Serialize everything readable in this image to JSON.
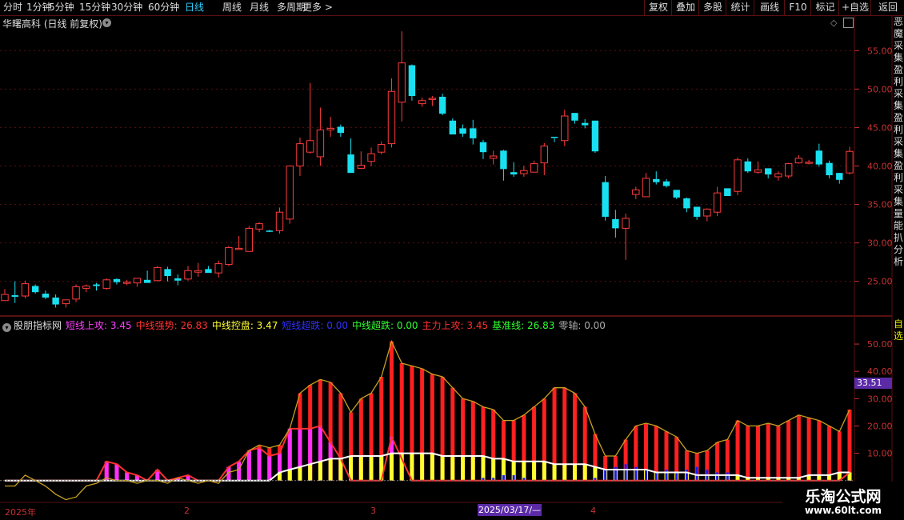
{
  "toolbar": {
    "periods": [
      "分时",
      "1分钟",
      "5分钟",
      "15分钟",
      "30分钟",
      "60分钟",
      "日线",
      "周线",
      "月线",
      "多周期",
      "更多 >"
    ],
    "active_period": "日线",
    "right_buttons": [
      "复权",
      "叠加",
      "多股",
      "统计",
      "画线",
      "F10",
      "标记",
      "+自选",
      "返回"
    ]
  },
  "stock": {
    "title": "华曙高科 (日线 前复权)"
  },
  "side_text": "恶魔采集盈利采集盈利采集盈利采集量能扒分析",
  "side_text_2": "自选",
  "indicator": {
    "name": "股朋指标网",
    "values": [
      {
        "label": "短线上攻:",
        "value": "3.45",
        "color": "#ff40ff"
      },
      {
        "label": "中线强势:",
        "value": "26.83",
        "color": "#ff3030"
      },
      {
        "label": "中线控盘:",
        "value": "3.47",
        "color": "#ffff30"
      },
      {
        "label": "短线超跌:",
        "value": "0.00",
        "color": "#3030ff"
      },
      {
        "label": "中线超跌:",
        "value": "0.00",
        "color": "#30ff30"
      },
      {
        "label": "主力上攻:",
        "value": "3.45",
        "color": "#ff3030"
      },
      {
        "label": "基准线:",
        "value": "26.83",
        "color": "#30ff30"
      },
      {
        "label": "零轴:",
        "value": "0.00",
        "color": "#aaaaaa"
      }
    ],
    "current_label": "33.51"
  },
  "x_axis": {
    "labels": [
      "2025年",
      "2",
      "3",
      "4"
    ],
    "date_badge": "2025/03/17/—"
  },
  "watermark": {
    "title": "乐淘公式网",
    "url": "www.60lt.com"
  },
  "colors": {
    "up": "#ff3c3c",
    "down": "#19e0f0",
    "grid": "#5a1010",
    "axis": "#c83232"
  },
  "chart_data": [
    {
      "type": "candlestick",
      "ylabel_ticks": [
        "55.00",
        "50.00",
        "45.00",
        "40.00",
        "35.00",
        "30.00",
        "25.00"
      ],
      "y_ticks": [
        55,
        50,
        45,
        40,
        35,
        30,
        25
      ],
      "ylim": [
        20.5,
        59.5
      ],
      "ohlc": [
        [
          22.5,
          24.0,
          22.5,
          23.3
        ],
        [
          23.2,
          25.0,
          22.2,
          23.0
        ],
        [
          23.1,
          25.1,
          22.8,
          24.7
        ],
        [
          24.4,
          24.6,
          23.4,
          23.6
        ],
        [
          23.4,
          23.8,
          22.7,
          22.9
        ],
        [
          22.9,
          23.3,
          21.6,
          22.0
        ],
        [
          22.1,
          22.6,
          21.6,
          22.6
        ],
        [
          22.7,
          24.6,
          22.3,
          24.3
        ],
        [
          24.1,
          24.6,
          23.6,
          24.4
        ],
        [
          24.6,
          24.8,
          23.8,
          24.4
        ],
        [
          24.1,
          25.4,
          23.9,
          25.2
        ],
        [
          25.3,
          25.4,
          24.6,
          24.9
        ],
        [
          24.9,
          25.2,
          24.5,
          24.9
        ],
        [
          24.8,
          25.4,
          24.3,
          25.4
        ],
        [
          25.2,
          26.4,
          25.1,
          24.8
        ],
        [
          25.1,
          27.0,
          25.0,
          26.8
        ],
        [
          26.6,
          26.9,
          25.0,
          25.7
        ],
        [
          25.4,
          25.9,
          24.5,
          25.1
        ],
        [
          25.3,
          27.0,
          25.1,
          26.4
        ],
        [
          26.2,
          27.4,
          25.6,
          26.4
        ],
        [
          26.6,
          27.0,
          26.2,
          26.1
        ],
        [
          26.1,
          27.7,
          25.5,
          27.3
        ],
        [
          27.2,
          29.6,
          27.0,
          29.4
        ],
        [
          29.3,
          30.9,
          29.2,
          29.3
        ],
        [
          28.9,
          32.2,
          28.9,
          31.9
        ],
        [
          31.8,
          32.7,
          31.4,
          32.5
        ],
        [
          31.6,
          31.7,
          31.4,
          31.5
        ],
        [
          31.6,
          34.6,
          31.2,
          34.0
        ],
        [
          33.1,
          40.1,
          32.5,
          40.0
        ],
        [
          40.0,
          43.7,
          38.7,
          42.9
        ],
        [
          41.8,
          50.8,
          41.6,
          43.3
        ],
        [
          41.2,
          47.6,
          40.0,
          44.7
        ],
        [
          44.7,
          46.4,
          43.8,
          44.9
        ],
        [
          45.1,
          45.4,
          43.8,
          44.3
        ],
        [
          41.5,
          43.6,
          39.2,
          39.1
        ],
        [
          39.7,
          41.9,
          39.6,
          40.1
        ],
        [
          40.6,
          42.4,
          40.0,
          41.6
        ],
        [
          41.8,
          43.2,
          41.5,
          42.8
        ],
        [
          42.9,
          51.4,
          42.4,
          49.7
        ],
        [
          48.3,
          57.5,
          45.8,
          53.4
        ],
        [
          53.1,
          53.2,
          48.5,
          49.1
        ],
        [
          48.1,
          48.9,
          47.7,
          48.5
        ],
        [
          48.8,
          49.1,
          47.8,
          48.8
        ],
        [
          49.0,
          49.4,
          46.6,
          46.8
        ],
        [
          45.9,
          46.2,
          44.4,
          44.1
        ],
        [
          44.9,
          45.4,
          43.8,
          44.2
        ],
        [
          44.9,
          46.0,
          42.8,
          43.6
        ],
        [
          43.1,
          43.4,
          40.9,
          41.8
        ],
        [
          41.0,
          42.0,
          40.2,
          41.3
        ],
        [
          42.0,
          42.1,
          38.1,
          39.6
        ],
        [
          39.2,
          40.5,
          38.6,
          38.9
        ],
        [
          39.0,
          40.0,
          38.6,
          39.4
        ],
        [
          39.2,
          40.7,
          39.2,
          40.3
        ],
        [
          40.4,
          43.0,
          38.8,
          42.6
        ],
        [
          43.8,
          43.6,
          43.1,
          43.7
        ],
        [
          43.3,
          47.3,
          42.6,
          46.5
        ],
        [
          46.9,
          46.7,
          45.5,
          45.9
        ],
        [
          45.6,
          46.1,
          44.9,
          45.3
        ],
        [
          45.9,
          45.2,
          41.7,
          41.9
        ],
        [
          37.9,
          38.7,
          32.9,
          33.4
        ],
        [
          33.1,
          34.3,
          30.7,
          31.9
        ],
        [
          31.9,
          33.8,
          27.8,
          33.2
        ],
        [
          36.3,
          37.3,
          35.7,
          36.9
        ],
        [
          36.0,
          39.1,
          36.0,
          38.4
        ],
        [
          38.3,
          39.3,
          37.6,
          37.9
        ],
        [
          38.0,
          38.3,
          37.2,
          37.4
        ],
        [
          36.9,
          36.8,
          35.7,
          35.9
        ],
        [
          35.8,
          35.9,
          34.0,
          34.5
        ],
        [
          34.7,
          34.1,
          33.0,
          33.4
        ],
        [
          33.5,
          34.5,
          32.8,
          34.4
        ],
        [
          34.0,
          37.3,
          33.5,
          36.5
        ],
        [
          37.1,
          37.0,
          36.2,
          36.1
        ],
        [
          36.7,
          41.1,
          36.2,
          40.8
        ],
        [
          40.6,
          41.0,
          39.1,
          39.3
        ],
        [
          39.2,
          40.6,
          39.0,
          39.5
        ],
        [
          39.7,
          39.7,
          38.4,
          38.9
        ],
        [
          38.6,
          39.3,
          38.1,
          39.0
        ],
        [
          38.7,
          40.4,
          38.4,
          40.3
        ],
        [
          40.4,
          41.4,
          40.3,
          41.0
        ],
        [
          40.5,
          40.8,
          40.2,
          40.5
        ],
        [
          42.0,
          42.9,
          39.9,
          40.2
        ],
        [
          40.4,
          40.7,
          38.4,
          38.8
        ],
        [
          39.1,
          39.1,
          37.7,
          38.2
        ],
        [
          39.1,
          42.5,
          38.9,
          41.9
        ]
      ]
    },
    {
      "type": "bar",
      "ylabel_ticks": [
        "50.00",
        "40.00",
        "30.00",
        "20.00",
        "10.00"
      ],
      "y_ticks": [
        50,
        40,
        30,
        20,
        10
      ],
      "ylim": [
        -8,
        55
      ],
      "series": [
        {
          "name": "中线强势",
          "color": "#ff2020",
          "values": [
            0,
            0,
            0,
            0,
            0,
            0,
            0,
            0,
            0,
            0,
            7,
            6,
            3,
            2,
            0,
            4,
            0,
            1,
            2,
            0,
            0,
            0,
            5,
            6,
            11,
            13,
            12,
            13,
            19,
            32,
            35,
            37,
            36,
            32,
            25,
            30,
            32,
            38,
            51,
            43,
            42,
            41,
            39,
            38,
            34,
            30,
            29,
            27,
            26,
            22,
            22,
            24,
            27,
            30,
            34,
            34,
            32,
            27,
            17,
            9,
            9,
            15,
            20,
            21,
            20,
            18,
            16,
            11,
            10,
            11,
            14,
            15,
            22,
            20,
            20,
            21,
            20,
            22,
            24,
            23,
            22,
            20,
            18,
            26
          ]
        },
        {
          "name": "短线上攻",
          "color": "#ff30ff",
          "values": [
            0,
            0,
            0,
            0,
            0,
            0,
            0,
            0,
            0,
            0,
            7,
            6,
            3,
            2,
            0,
            4,
            0,
            1,
            2,
            0,
            0,
            0,
            5,
            7,
            11,
            12,
            9,
            10,
            19,
            19,
            19,
            20,
            14,
            8,
            0,
            0,
            0,
            0,
            16,
            8,
            0,
            0,
            0,
            0,
            0,
            0,
            0,
            0,
            0,
            0,
            0,
            0,
            0,
            0,
            0,
            0,
            0,
            0,
            0,
            0,
            0,
            0,
            0,
            0,
            0,
            0,
            0,
            0,
            0,
            0,
            0,
            0,
            0,
            0,
            0,
            0,
            0,
            0,
            0,
            0,
            0,
            0,
            0,
            3
          ]
        },
        {
          "name": "中线控盘",
          "color": "#ffff30",
          "values": [
            0,
            0,
            0,
            0,
            0,
            0,
            0,
            0,
            0,
            0,
            0,
            0,
            0,
            0,
            0,
            0,
            0,
            0,
            0,
            0,
            0,
            0,
            0,
            0,
            0,
            0,
            0,
            3,
            4,
            5,
            6,
            7,
            8,
            8,
            9,
            9,
            9,
            9,
            10,
            10,
            10,
            10,
            10,
            9,
            9,
            9,
            9,
            9,
            8,
            8,
            7,
            7,
            7,
            7,
            6,
            6,
            6,
            6,
            5,
            4,
            4,
            4,
            4,
            4,
            3,
            3,
            3,
            3,
            2,
            2,
            2,
            2,
            2,
            1,
            1,
            1,
            1,
            1,
            1,
            2,
            2,
            2,
            3,
            3
          ]
        },
        {
          "name": "短线超跌",
          "color": "#1a1aff",
          "values": [
            0,
            0,
            0,
            0,
            0,
            0,
            0,
            0,
            0,
            0,
            0,
            0,
            0,
            0,
            0,
            0,
            0,
            0,
            0,
            0,
            0,
            0,
            0,
            0,
            0,
            0,
            0,
            0,
            0,
            0,
            0,
            0,
            0,
            0,
            0,
            0,
            0,
            0,
            0,
            0,
            0,
            0,
            0,
            0,
            0,
            0,
            0,
            1,
            1,
            2,
            2,
            1,
            0,
            0,
            0,
            0,
            0,
            0,
            1,
            4,
            5,
            6,
            5,
            4,
            3,
            4,
            3,
            4,
            5,
            4,
            3,
            3,
            0,
            0,
            0,
            0,
            0,
            0,
            0,
            0,
            0,
            0,
            0,
            0
          ]
        },
        {
          "name": "基准线",
          "color": "#c8a020",
          "values": [
            -2,
            -2,
            2,
            0,
            -2,
            -5,
            -7,
            -6,
            -2,
            -1,
            1,
            0,
            0,
            -1,
            0,
            0,
            -1,
            1,
            0,
            -1,
            0,
            -1,
            3,
            4,
            11,
            13,
            12,
            13,
            19,
            32,
            35,
            37,
            36,
            32,
            25,
            30,
            32,
            38,
            51,
            43,
            42,
            41,
            39,
            38,
            34,
            30,
            29,
            27,
            26,
            22,
            22,
            24,
            27,
            30,
            34,
            34,
            32,
            27,
            17,
            9,
            9,
            15,
            20,
            21,
            20,
            18,
            16,
            11,
            10,
            11,
            14,
            15,
            22,
            20,
            20,
            21,
            20,
            22,
            24,
            23,
            22,
            20,
            18,
            26
          ]
        }
      ]
    }
  ]
}
